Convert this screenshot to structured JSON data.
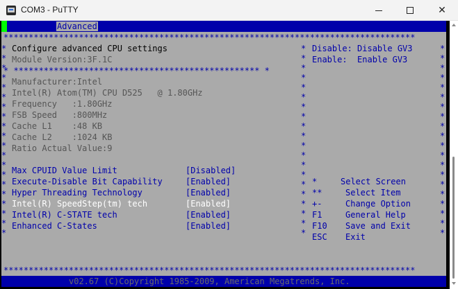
{
  "window": {
    "title": "COM3 - PuTTY",
    "minimize": "—",
    "maximize": "☐",
    "close": "✕"
  },
  "bios": {
    "tab": "Advanced",
    "border_top": "**********************************************************************************",
    "border_mid": "************************************************** *",
    "border_bottom": "**********************************************************************************",
    "left": {
      "title": "Configure advanced CPU settings",
      "module_version": "Module Version:3F.1C",
      "manufacturer": "Manufacturer:Intel",
      "cpu": "Intel(R) Atom(TM) CPU D525   @ 1.80GHz",
      "frequency": "Frequency   :1.80GHz",
      "fsb_speed": "FSB Speed   :800MHz",
      "cache_l1": "Cache L1    :48 KB",
      "cache_l2": "Cache L2    :1024 KB",
      "ratio": "Ratio Actual Value:9",
      "options": [
        {
          "label": "Max CPUID Value Limit",
          "value": "[Disabled]"
        },
        {
          "label": "Execute-Disable Bit Capability",
          "value": "[Enabled]"
        },
        {
          "label": "Hyper Threading Technology",
          "value": "[Enabled]"
        },
        {
          "label": "Intel(R) SpeedStep(tm) tech",
          "value": "[Enabled]"
        },
        {
          "label": "Intel(R) C-STATE tech",
          "value": "[Enabled]"
        },
        {
          "label": "Enhanced C-States",
          "value": "[Enabled]"
        }
      ]
    },
    "right": {
      "help_1": "Disable: Disable GV3",
      "help_2": "Enable:  Enable GV3",
      "keys": [
        {
          "key": "*",
          "action": "Select Screen"
        },
        {
          "key": "**",
          "action": "Select Item"
        },
        {
          "key": "+-",
          "action": "Change Option"
        },
        {
          "key": "F1",
          "action": "General Help"
        },
        {
          "key": "F10",
          "action": "Save and Exit"
        },
        {
          "key": "ESC",
          "action": "Exit"
        }
      ]
    },
    "footer": "v02.67 (C)Copyright 1985-2009, American Megatrends, Inc."
  }
}
